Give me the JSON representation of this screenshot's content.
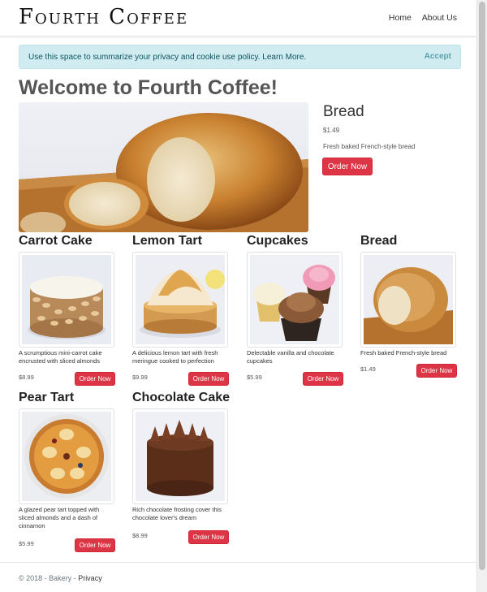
{
  "brand": "Fourth Coffee",
  "nav": {
    "home": "Home",
    "about": "About Us"
  },
  "cookie": {
    "text": "Use this space to summarize your privacy and cookie use policy.",
    "link": "Learn More.",
    "accept": "Accept"
  },
  "welcome": "Welcome to Fourth Coffee!",
  "featured": {
    "name": "Bread",
    "price": "$1.49",
    "description": "Fresh baked French-style bread",
    "button": "Order Now"
  },
  "products": [
    {
      "name": "Carrot Cake",
      "description": "A scrumptious mini-carrot cake encrusted with sliced almonds",
      "price": "$8.99",
      "button": "Order Now"
    },
    {
      "name": "Lemon Tart",
      "description": "A delicious lemon tart with fresh meringue cooked to perfection",
      "price": "$9.99",
      "button": "Order Now"
    },
    {
      "name": "Cupcakes",
      "description": "Delectable vanilla and chocolate cupcakes",
      "price": "$5.99",
      "button": "Order Now"
    },
    {
      "name": "Bread",
      "description": "Fresh baked French-style bread",
      "price": "$1.49",
      "button": "Order Now"
    },
    {
      "name": "Pear Tart",
      "description": "A glazed pear tart topped with sliced almonds and a dash of cinnamon",
      "price": "$5.99",
      "button": "Order Now"
    },
    {
      "name": "Chocolate Cake",
      "description": "Rich chocolate frosting cover this chocolate lover's dream",
      "price": "$8.99",
      "button": "Order Now"
    }
  ],
  "footer": {
    "copyright": "© 2018 - Bakery -",
    "privacy": "Privacy"
  },
  "colors": {
    "button": "#dc3545",
    "cookie_bg": "#d1ecf1",
    "cookie_text": "#0c5460"
  }
}
